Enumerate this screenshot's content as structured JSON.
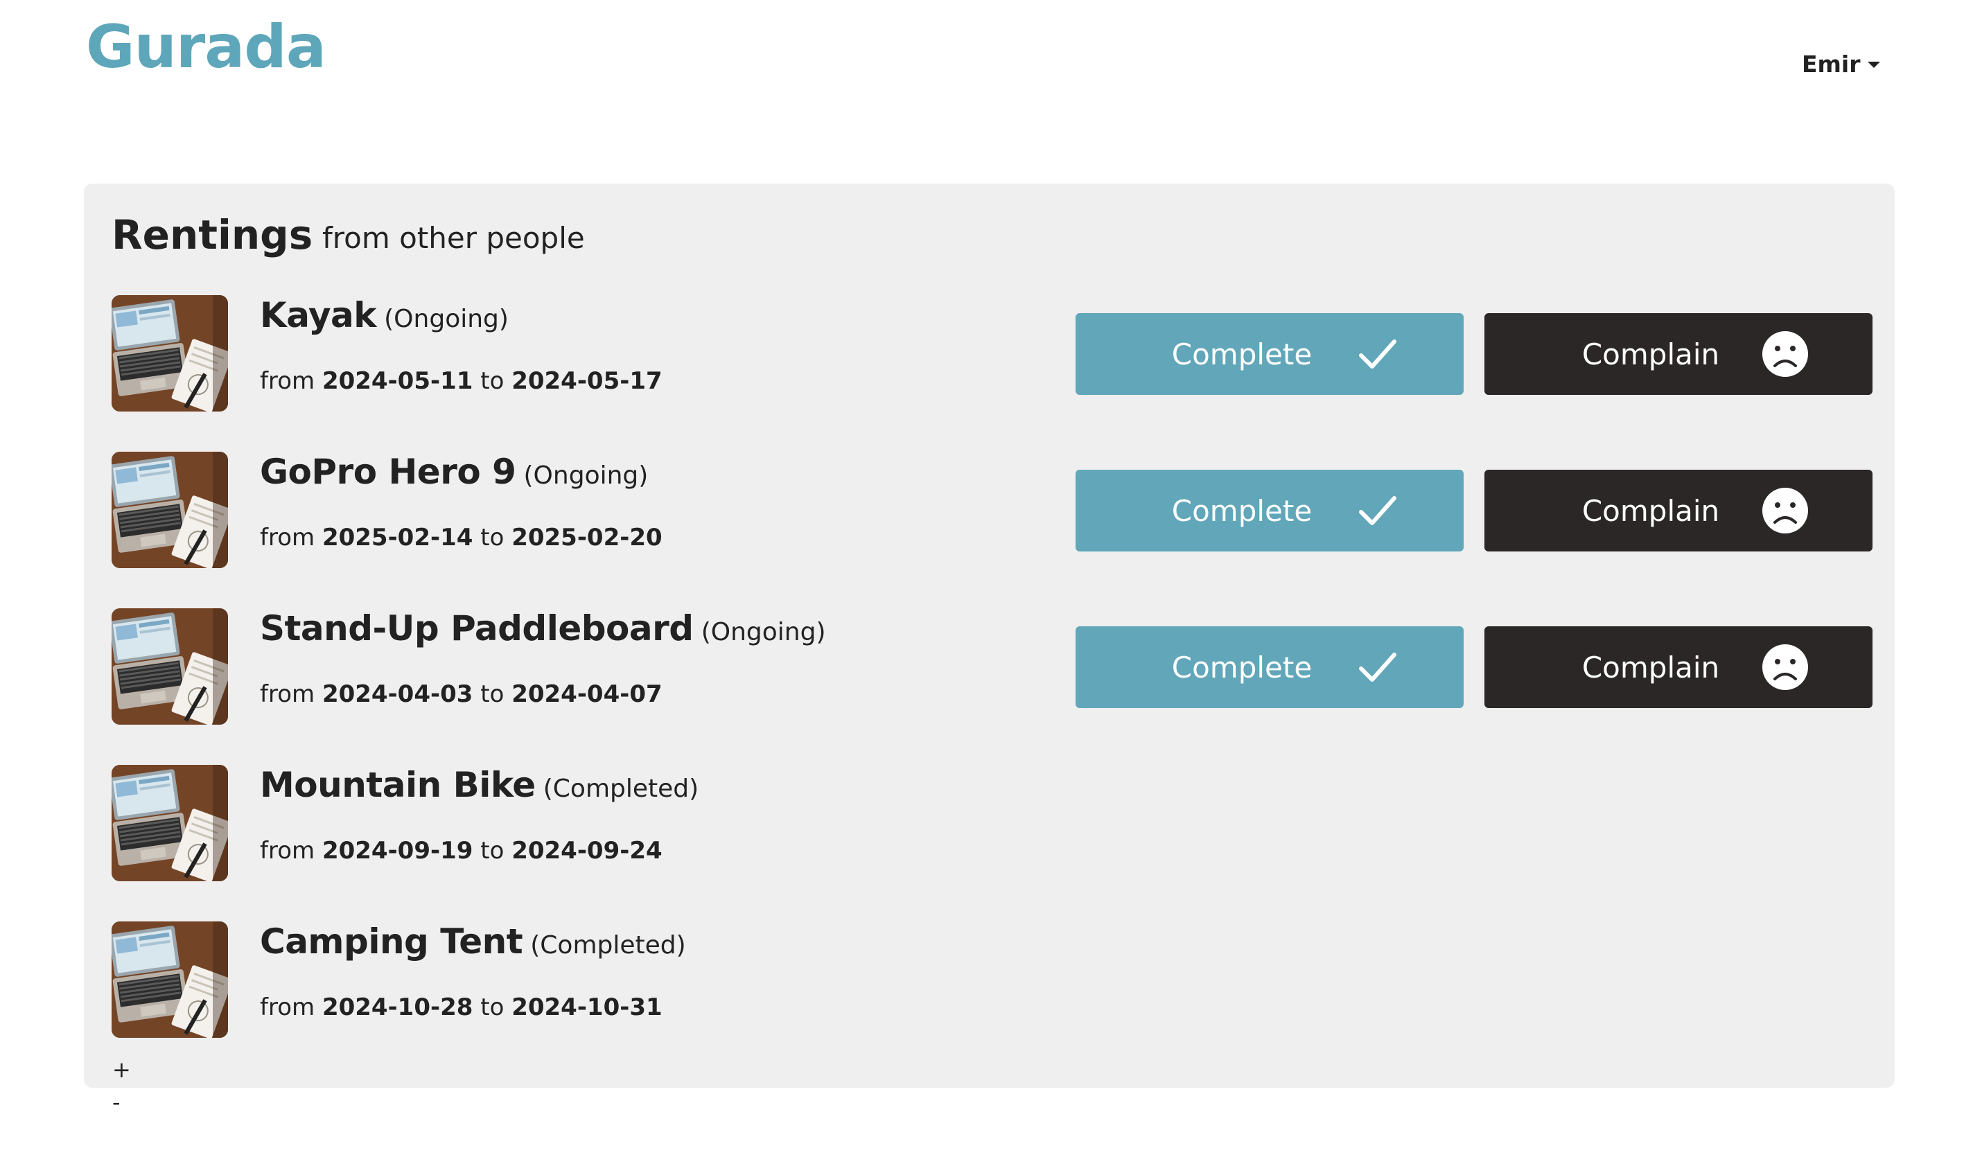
{
  "header": {
    "brand": "Gurada",
    "user_name": "Emir"
  },
  "panel": {
    "title": "Rentings",
    "subtitle": "from other people"
  },
  "rentals": [
    {
      "name": "Kayak",
      "status": "(Ongoing)",
      "from_label": "from",
      "from": "2024-05-11",
      "to_label": "to",
      "to": "2024-05-17",
      "has_actions": true
    },
    {
      "name": "GoPro Hero 9",
      "status": "(Ongoing)",
      "from_label": "from",
      "from": "2025-02-14",
      "to_label": "to",
      "to": "2025-02-20",
      "has_actions": true
    },
    {
      "name": "Stand-Up Paddleboard",
      "status": "(Ongoing)",
      "from_label": "from",
      "from": "2024-04-03",
      "to_label": "to",
      "to": "2024-04-07",
      "has_actions": true
    },
    {
      "name": "Mountain Bike",
      "status": "(Completed)",
      "from_label": "from",
      "from": "2024-09-19",
      "to_label": "to",
      "to": "2024-09-24",
      "has_actions": false
    },
    {
      "name": "Camping Tent",
      "status": "(Completed)",
      "from_label": "from",
      "from": "2024-10-28",
      "to_label": "to",
      "to": "2024-10-31",
      "has_actions": false
    }
  ],
  "actions": {
    "complete_label": "Complete",
    "complete_icon": "checkmark-icon",
    "complain_label": "Complain",
    "complain_icon": "sad-face-icon"
  },
  "pagination": {
    "plus": "+",
    "minus": "-"
  },
  "colors": {
    "brand": "#5ea6b9",
    "complete_button": "#61a6b9",
    "complain_button": "#2b2727",
    "panel_background": "#efefef"
  }
}
